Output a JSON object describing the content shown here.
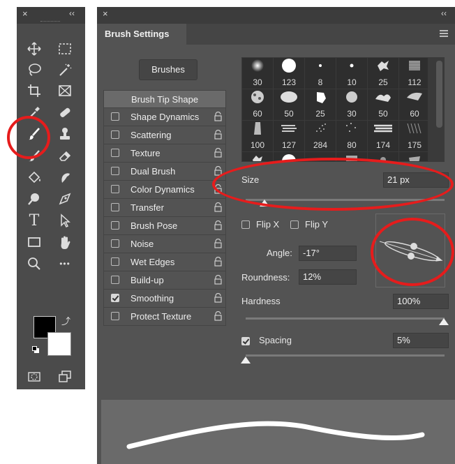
{
  "toolbar": {
    "close_label": "×",
    "collapse_label": "‹‹",
    "tools": [
      {
        "name": "move-tool",
        "icon": "move-icon"
      },
      {
        "name": "marquee-tool",
        "icon": "marquee-icon"
      },
      {
        "name": "lasso-tool",
        "icon": "lasso-icon"
      },
      {
        "name": "magic-wand-tool",
        "icon": "magic-wand-icon"
      },
      {
        "name": "crop-tool",
        "icon": "crop-icon"
      },
      {
        "name": "frame-tool",
        "icon": "frame-icon"
      },
      {
        "name": "eyedropper-tool",
        "icon": "eyedropper-icon"
      },
      {
        "name": "healing-tool",
        "icon": "bandage-icon"
      },
      {
        "name": "brush-tool",
        "icon": "brush-icon"
      },
      {
        "name": "stamp-tool",
        "icon": "stamp-icon"
      },
      {
        "name": "history-brush-tool",
        "icon": "history-brush-icon"
      },
      {
        "name": "eraser-tool",
        "icon": "eraser-icon"
      },
      {
        "name": "bucket-tool",
        "icon": "paint-bucket-icon"
      },
      {
        "name": "smudge-tool",
        "icon": "smudge-icon"
      },
      {
        "name": "dodge-tool",
        "icon": "dodge-icon"
      },
      {
        "name": "pen-tool",
        "icon": "pen-icon"
      },
      {
        "name": "type-tool",
        "icon": "type-icon",
        "glyph": "T"
      },
      {
        "name": "select-tool",
        "icon": "arrow-icon"
      },
      {
        "name": "shape-tool",
        "icon": "rectangle-icon"
      },
      {
        "name": "hand-tool",
        "icon": "hand-icon"
      },
      {
        "name": "zoom-tool",
        "icon": "magnifier-icon"
      },
      {
        "name": "more-tools",
        "icon": "ellipsis-icon",
        "glyph": "•••"
      }
    ],
    "foreground_color": "#000000",
    "background_color": "#ffffff"
  },
  "panel": {
    "close_label": "×",
    "collapse_label": "‹‹",
    "tab_title": "Brush Settings",
    "brushes_button": "Brushes",
    "tip_shape_label": "Brush Tip Shape",
    "options": [
      {
        "label": "Shape Dynamics",
        "checked": false
      },
      {
        "label": "Scattering",
        "checked": false
      },
      {
        "label": "Texture",
        "checked": false
      },
      {
        "label": "Dual Brush",
        "checked": false
      },
      {
        "label": "Color Dynamics",
        "checked": false
      },
      {
        "label": "Transfer",
        "checked": false
      },
      {
        "label": "Brush Pose",
        "checked": false
      },
      {
        "label": "Noise",
        "checked": false
      },
      {
        "label": "Wet Edges",
        "checked": false
      },
      {
        "label": "Build-up",
        "checked": false
      },
      {
        "label": "Smoothing",
        "checked": true
      },
      {
        "label": "Protect Texture",
        "checked": false
      }
    ],
    "brush_presets": [
      "30",
      "123",
      "8",
      "10",
      "25",
      "112",
      "60",
      "50",
      "25",
      "30",
      "50",
      "60",
      "100",
      "127",
      "284",
      "80",
      "174",
      "175"
    ],
    "size_label": "Size",
    "size_value": "21 px",
    "flip_x_label": "Flip X",
    "flip_y_label": "Flip Y",
    "angle_label": "Angle:",
    "angle_value": "-17°",
    "roundness_label": "Roundness:",
    "roundness_value": "12%",
    "hardness_label": "Hardness",
    "hardness_value": "100%",
    "spacing_label": "Spacing",
    "spacing_value": "5%",
    "spacing_checked": true
  },
  "colors": {
    "annotation_red": "#e61c1c",
    "panel_bg": "#535353",
    "toolbar_bg": "#4b4b4b"
  }
}
